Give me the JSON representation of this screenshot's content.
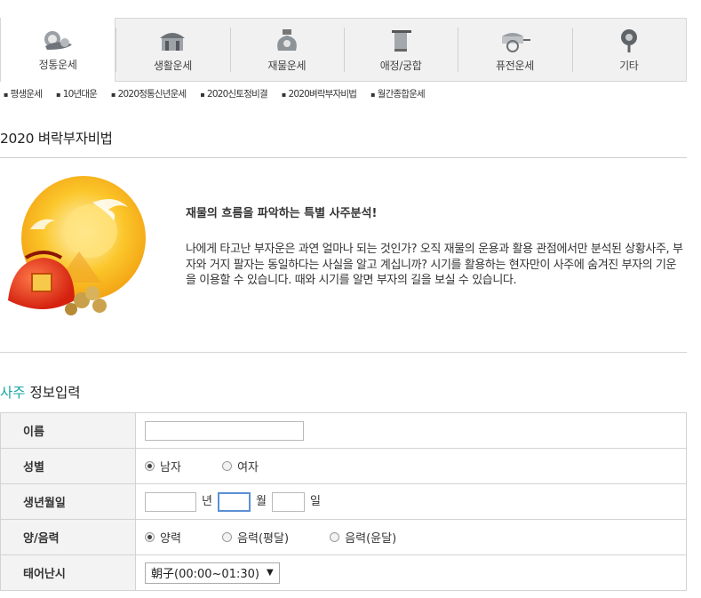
{
  "nav": {
    "tabs": [
      {
        "label": "정통운세",
        "icon": "cloud-icon",
        "active": true
      },
      {
        "label": "생활운세",
        "icon": "house-icon",
        "active": false
      },
      {
        "label": "재물운세",
        "icon": "money-bag-icon",
        "active": false
      },
      {
        "label": "애정/궁합",
        "icon": "lantern-icon",
        "active": false
      },
      {
        "label": "퓨전운세",
        "icon": "cart-icon",
        "active": false
      },
      {
        "label": "기타",
        "icon": "pin-icon",
        "active": false
      }
    ]
  },
  "submenu": [
    "평생운세",
    "10년대운",
    "2020정통신년운세",
    "2020신토정비결",
    "2020벼락부자비법",
    "월간종합운세"
  ],
  "section_title": "2020 벼락부자비법",
  "intro": {
    "heading": "재물의 흐름을 파악하는 특별 사주분석!",
    "body": "나에게 타고난 부자운은 과연 얼마나 되는 것인가? 오직 재물의 운용과 활용 관점에서만 분석된 상황사주, 부자와 거지 팔자는 동일하다는 사실을 알고 계십니까? 시기를 활용하는 현자만이 사주에 숨겨진 부자의 기운을 이용할 수 있습니다. 때와 시기를 알면 부자의 길을 보실 수 있습니다."
  },
  "form": {
    "title_accent": "사주",
    "title_rest": " 정보입력",
    "name_label": "이름",
    "name_value": "",
    "gender_label": "성별",
    "gender_options": [
      "남자",
      "여자"
    ],
    "gender_selected": "남자",
    "birth_label": "생년월일",
    "birth_year": "",
    "birth_month": "",
    "birth_day": "",
    "unit_year": "년",
    "unit_month": "월",
    "unit_day": "일",
    "calendar_label": "양/음력",
    "calendar_options": [
      "양력",
      "음력(평달)",
      "음력(윤달)"
    ],
    "calendar_selected": "양력",
    "time_label": "태어난시",
    "time_value": "朝子(00:00~01:30)"
  },
  "colors": {
    "accent": "#1aa5a5",
    "nav_bg": "#f1f1f1",
    "label_bg": "#f3f3f3"
  }
}
